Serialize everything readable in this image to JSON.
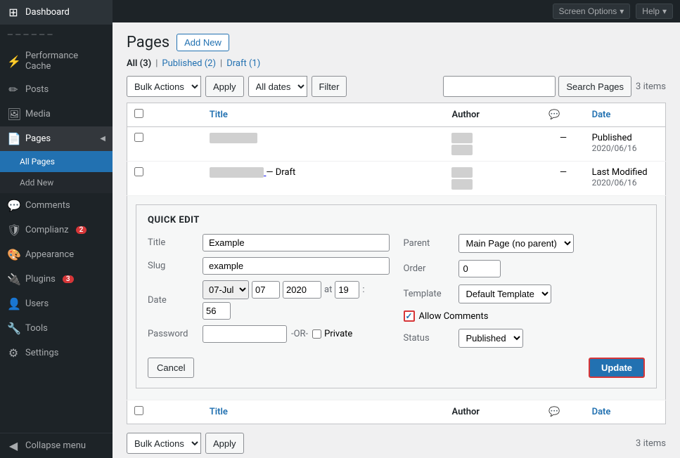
{
  "topbar": {
    "screen_options": "Screen Options",
    "help": "Help"
  },
  "sidebar": {
    "dashboard": "Dashboard",
    "site_name": "— — — — — —",
    "performance_cache": "Performance Cache",
    "posts": "Posts",
    "media": "Media",
    "pages": "Pages",
    "all_pages": "All Pages",
    "add_new": "Add New",
    "comments": "Comments",
    "complianz": "Complianz",
    "complianz_badge": "2",
    "appearance": "Appearance",
    "plugins": "Plugins",
    "plugins_badge": "3",
    "users": "Users",
    "tools": "Tools",
    "settings": "Settings",
    "collapse_menu": "Collapse menu"
  },
  "page": {
    "title": "Pages",
    "add_new_label": "Add New"
  },
  "filters": {
    "all_label": "All",
    "all_count": "3",
    "published_label": "Published",
    "published_count": "2",
    "draft_label": "Draft",
    "draft_count": "1",
    "bulk_actions": "Bulk Actions",
    "apply": "Apply",
    "all_dates": "All dates",
    "filter": "Filter",
    "search_placeholder": "",
    "search_btn": "Search Pages",
    "items_count": "3 items"
  },
  "table": {
    "col_title": "Title",
    "col_author": "Author",
    "col_date": "Date",
    "rows": [
      {
        "id": 1,
        "title": "—————————————",
        "author_line1": "——————————",
        "author_line2": "——————————",
        "comment_count": "—",
        "status": "Published",
        "date": "2020/06/16"
      },
      {
        "id": 2,
        "title": "———————————————",
        "title_suffix": "— Draft",
        "author_line1": "——————————",
        "author_line2": "——————————",
        "comment_count": "—",
        "status": "Last Modified",
        "date": "2020/06/16"
      }
    ]
  },
  "quick_edit": {
    "section_title": "QUICK EDIT",
    "title_label": "Title",
    "title_value": "Example",
    "slug_label": "Slug",
    "slug_value": "example",
    "date_label": "Date",
    "date_month": "07-Jul",
    "date_day": "07",
    "date_year": "2020",
    "date_at": "at",
    "date_hour": "19",
    "date_colon": ":",
    "date_seconds": "56",
    "password_label": "Password",
    "password_value": "",
    "or_label": "-OR-",
    "private_label": "Private",
    "parent_label": "Parent",
    "parent_value": "Main Page (no parent)",
    "order_label": "Order",
    "order_value": "0",
    "template_label": "Template",
    "template_value": "Default Template",
    "allow_comments_label": "Allow Comments",
    "status_label": "Status",
    "status_value": "Published",
    "cancel_label": "Cancel",
    "update_label": "Update"
  },
  "bottom": {
    "bulk_actions": "Bulk Actions",
    "apply": "Apply",
    "items_count": "3 items",
    "col_title": "Title",
    "col_author": "Author",
    "col_date": "Date"
  }
}
